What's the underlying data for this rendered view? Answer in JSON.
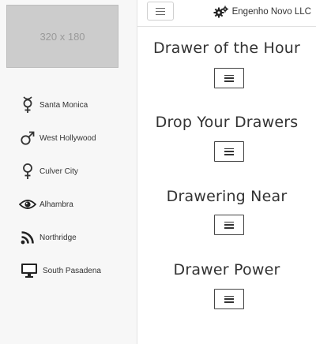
{
  "sidebar": {
    "image_placeholder": "320 x 180",
    "items": [
      {
        "label": "Santa Monica",
        "icon": "transgender-icon"
      },
      {
        "label": "West Hollywood",
        "icon": "mars-icon"
      },
      {
        "label": "Culver City",
        "icon": "venus-icon"
      },
      {
        "label": "Alhambra",
        "icon": "eye-icon"
      },
      {
        "label": "Northridge",
        "icon": "rss-icon"
      },
      {
        "label": "South Pasadena",
        "icon": "desktop-icon"
      }
    ]
  },
  "header": {
    "company_name": "Engenho Novo LLC",
    "company_icon": "cogs-icon"
  },
  "main": {
    "sections": [
      {
        "title": "Drawer of the Hour"
      },
      {
        "title": "Drop Your Drawers"
      },
      {
        "title": "Drawering Near"
      },
      {
        "title": "Drawer Power"
      }
    ]
  }
}
